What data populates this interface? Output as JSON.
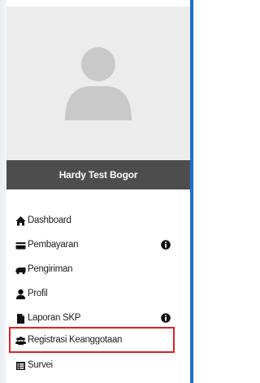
{
  "user": {
    "name": "Hardy Test Bogor"
  },
  "menu": {
    "items": [
      {
        "label": "Dashboard",
        "icon": "home-icon",
        "badge": ""
      },
      {
        "label": "Pembayaran",
        "icon": "credit-card-icon",
        "badge": "info"
      },
      {
        "label": "Pengiriman",
        "icon": "truck-icon",
        "badge": ""
      },
      {
        "label": "Profil",
        "icon": "user-icon",
        "badge": ""
      },
      {
        "label": "Laporan SKP",
        "icon": "file-icon",
        "badge": "info"
      },
      {
        "label": "Registrasi Keanggotaan",
        "icon": "users-icon",
        "badge": "",
        "highlighted": true
      },
      {
        "label": "Survei",
        "icon": "list-icon",
        "badge": ""
      }
    ]
  },
  "colors": {
    "accent_blue": "#1f6dd1",
    "highlight_red": "#e02020",
    "name_bar": "#4d4d4d",
    "avatar_bg": "#ececec"
  }
}
